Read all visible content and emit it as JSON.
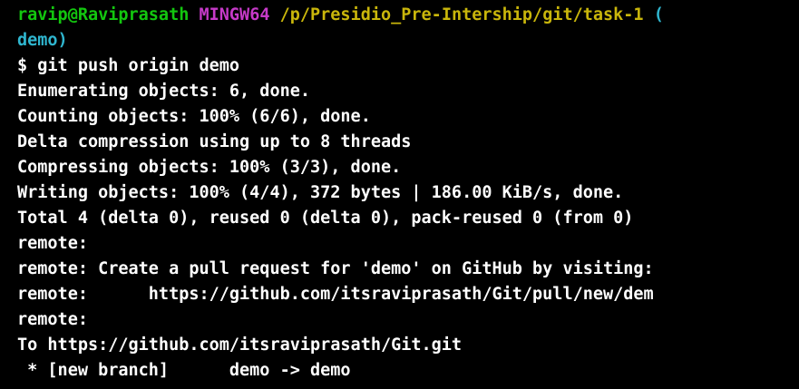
{
  "terminal": {
    "prompt": {
      "user_host": "ravip@Raviprasath",
      "system": "MINGW64",
      "path": "/p/Presidio_Pre-Intership/git/task-1",
      "branch_open": "(",
      "branch_close": "demo)"
    },
    "command": "$ git push origin demo",
    "output": [
      "Enumerating objects: 6, done.",
      "Counting objects: 100% (6/6), done.",
      "Delta compression using up to 8 threads",
      "Compressing objects: 100% (3/3), done.",
      "Writing objects: 100% (4/4), 372 bytes | 186.00 KiB/s, done.",
      "Total 4 (delta 0), reused 0 (delta 0), pack-reused 0 (from 0)",
      "remote:",
      "remote: Create a pull request for 'demo' on GitHub by visiting:",
      "remote:      https://github.com/itsraviprasath/Git/pull/new/dem",
      "remote:",
      "To https://github.com/itsraviprasath/Git.git",
      " * [new branch]      demo -> demo"
    ]
  },
  "colors": {
    "background": "#000000",
    "prompt_user_host": "#13c70f",
    "prompt_system": "#c63ac8",
    "prompt_path": "#c9b60b",
    "prompt_branch": "#2fb6cf",
    "output_text": "#ffffff"
  }
}
